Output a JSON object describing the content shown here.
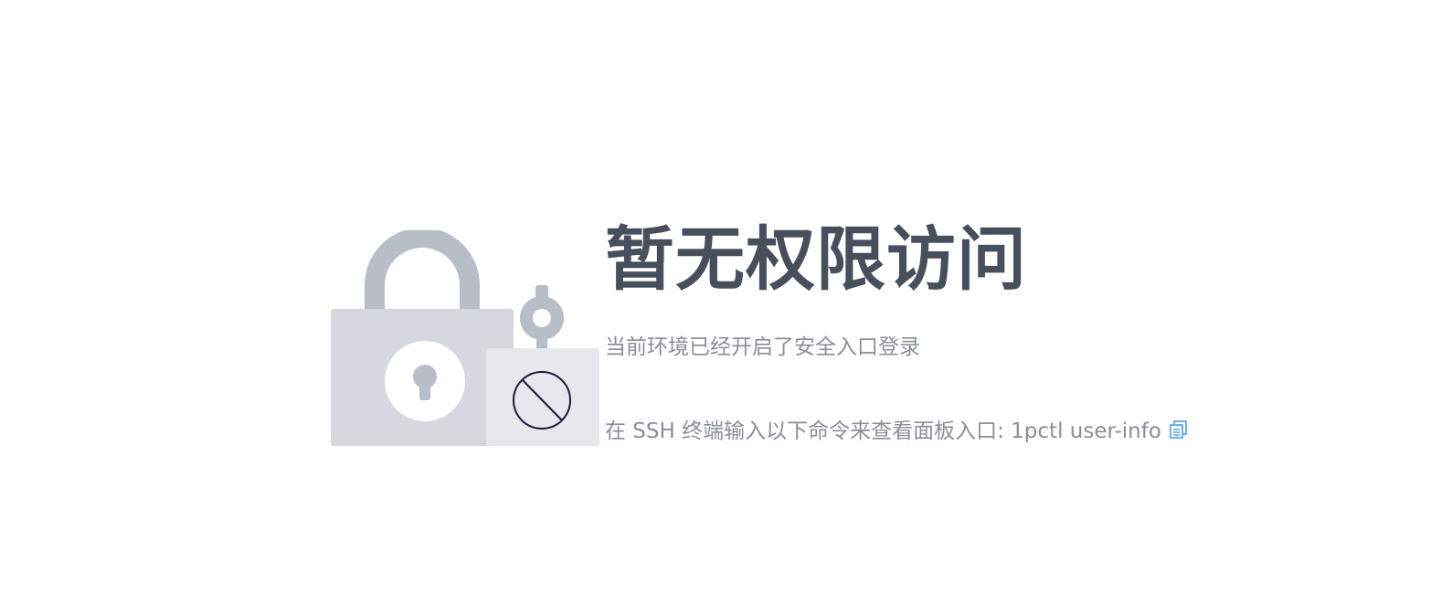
{
  "title": "暂无权限访问",
  "subtitle": "当前环境已经开启了安全入口登录",
  "hint": {
    "text": "在 SSH 终端输入以下命令来查看面板入口: 1pctl user-info",
    "copy_icon": "copy-icon"
  },
  "illustration": {
    "main_icon": "padlock-icon",
    "small_icon": "prohibited-icon"
  },
  "colors": {
    "title": "#464f5b",
    "text": "#8a8f97",
    "accent": "#4a9ff5",
    "lock_body": "#d5d9df",
    "lock_shackle": "#b8bec8",
    "small_lock_body": "#e6e8eb",
    "prohibited_stroke": "#1a1a3a"
  }
}
